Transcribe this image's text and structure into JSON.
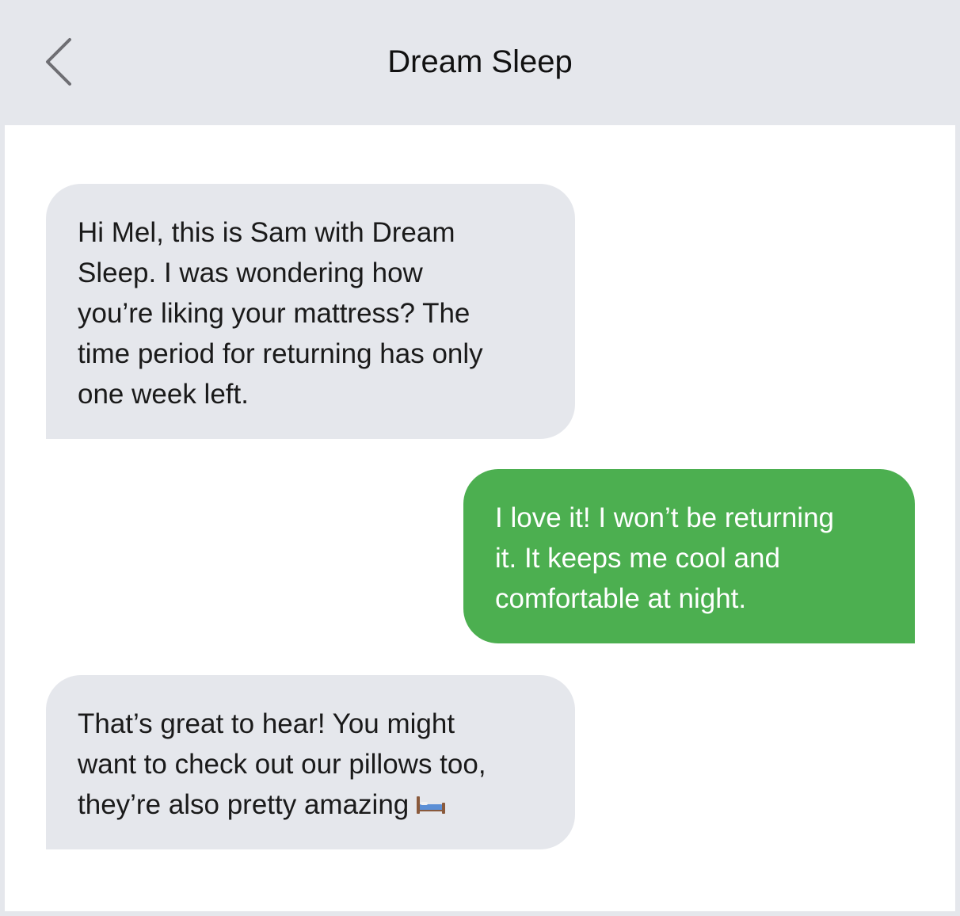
{
  "header": {
    "title": "Dream Sleep",
    "back_icon": "chevron-left-icon"
  },
  "messages": [
    {
      "direction": "incoming",
      "text": "Hi Mel, this is Sam with Dream\nSleep. I was wondering how\nyou’re liking your mattress? The\ntime period for returning has only\none week left."
    },
    {
      "direction": "outgoing",
      "text": "I love it! I won’t be returning\nit. It keeps me cool and\ncomfortable at night."
    },
    {
      "direction": "incoming",
      "text": "That’s great to hear! You might\nwant to check out our pillows too,\nthey’re also pretty amazing",
      "emoji": "bed-icon"
    }
  ],
  "colors": {
    "header_bg": "#e5e7ec",
    "incoming_bubble": "#e5e7ec",
    "outgoing_bubble": "#4caf50",
    "panel_bg": "#ffffff"
  }
}
